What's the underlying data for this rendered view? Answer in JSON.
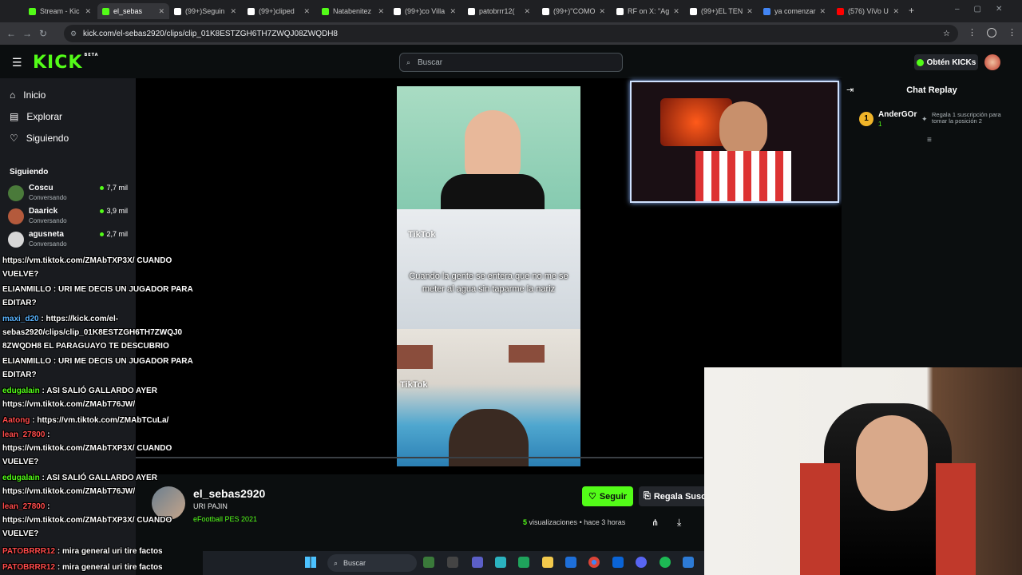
{
  "browser": {
    "tabs": [
      {
        "label": "Stream - Kic",
        "icon_color": "#53fc18"
      },
      {
        "label": "el_sebas",
        "icon_color": "#53fc18",
        "active": true
      },
      {
        "label": "(99+)Seguin",
        "icon_color": "#ffffff"
      },
      {
        "label": "(99+)cliped",
        "icon_color": "#ffffff"
      },
      {
        "label": "Natabenitez",
        "icon_color": "#53fc18"
      },
      {
        "label": "(99+)co Villa",
        "icon_color": "#ffffff"
      },
      {
        "label": "patobrrr12(",
        "icon_color": "#ffffff"
      },
      {
        "label": "(99+)\"COMO",
        "icon_color": "#ffffff"
      },
      {
        "label": "RF on X: \"Ag",
        "icon_color": "#ffffff"
      },
      {
        "label": "(99+)EL TEN",
        "icon_color": "#ffffff"
      },
      {
        "label": "ya comenzar",
        "icon_color": "#4285f4"
      },
      {
        "label": "(576) ViVo U",
        "icon_color": "#ff0000"
      }
    ],
    "new_tab": "+",
    "url": "kick.com/el-sebas2920/clips/clip_01K8ESTZGH6TH7ZWQJ08ZWQDH8"
  },
  "header": {
    "logo": "KICK",
    "beta": "BETA",
    "search_placeholder": "Buscar",
    "get_kicks": "Obtén KICKs"
  },
  "sidebar": {
    "nav": [
      {
        "label": "Inicio",
        "icon": "home-icon",
        "glyph": "⌂"
      },
      {
        "label": "Explorar",
        "icon": "compass-icon",
        "glyph": "▤"
      },
      {
        "label": "Siguiendo",
        "icon": "heart-icon",
        "glyph": "♡"
      }
    ],
    "following_title": "Siguiendo",
    "following": [
      {
        "name": "Coscu",
        "sub": "Conversando",
        "viewers": "7,7 mil",
        "color": "#4a7a3a"
      },
      {
        "name": "Daarick",
        "sub": "Conversando",
        "viewers": "3,9 mil",
        "color": "#b45a3c"
      },
      {
        "name": "agusneta",
        "sub": "Conversando",
        "viewers": "2,7 mil",
        "color": "#d7d7d7"
      }
    ]
  },
  "clip": {
    "caption": "Cuando la gente se entera que no me se meter al agua sin taparme la nariz",
    "tiktok_label": "TikTok"
  },
  "chat_replay": {
    "title": "Chat Replay",
    "gifter_rank": "1",
    "gifter_name": "AnderGOr",
    "gifter_count": "1",
    "gift_text": "Regala 1 suscripción para tomar la posición 2"
  },
  "channel": {
    "name": "el_sebas2920",
    "stream_title": "URI PAJIN",
    "category": "eFootball PES 2021",
    "follow_label": "Seguir",
    "gift_label": "Regala Susc",
    "views_count": "5",
    "views_label": "visualizaciones",
    "time_ago": "• hace 3 horas"
  },
  "chat_overlay": [
    {
      "user": "",
      "text": "https://vm.tiktok.com/ZMAbTXP3X/ CUANDO\nVUELVE?",
      "color": "u"
    },
    {
      "user": "ELIANMILLO",
      "text": " : URI ME DECIS UN JUGADOR PARA\nEDITAR?",
      "color": "u"
    },
    {
      "user": "maxi_d20",
      "text": " : https://kick.com/el-\nsebas2920/clips/clip_01K8ESTZGH6TH7ZWQJ0\n8ZWQDH8 EL PARAGUAYO TE DESCUBRIO",
      "color": "ub"
    },
    {
      "user": "ELIANMILLO",
      "text": " : URI ME DECIS UN JUGADOR PARA\nEDITAR?",
      "color": "u"
    },
    {
      "user": "edugalain",
      "text": " : ASI SALIÓ GALLARDO AYER\nhttps://vm.tiktok.com/ZMAbT76JW/",
      "color": "ug"
    },
    {
      "user": "Aatong",
      "text": " : https://vm.tiktok.com/ZMAbTCuLa/",
      "color": "ur"
    },
    {
      "user": "lean_27800",
      "text": " :\nhttps://vm.tiktok.com/ZMAbTXP3X/ CUANDO\nVUELVE?",
      "color": "ur"
    },
    {
      "user": "edugalain",
      "text": " : ASI SALIÓ GALLARDO AYER\nhttps://vm.tiktok.com/ZMAbT76JW/",
      "color": "ug"
    },
    {
      "user": "lean_27800",
      "text": " :\nhttps://vm.tiktok.com/ZMAbTXP3X/ CUANDO\nVUELVE?",
      "color": "ur"
    },
    {
      "user": "PATOBRRR12",
      "text": " : mira general uri tire factos",
      "color": "ur"
    },
    {
      "user": "PATOBRRR12",
      "text": " : mira general uri tire factos",
      "color": "ur"
    }
  ],
  "taskbar": {
    "search_placeholder": "Buscar"
  }
}
